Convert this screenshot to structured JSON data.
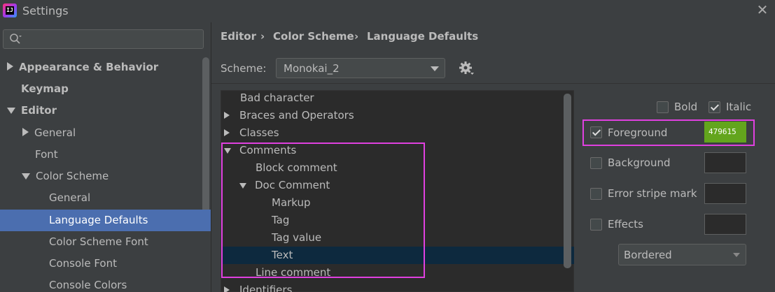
{
  "window": {
    "title": "Settings",
    "app_icon": "intellij-idea-icon",
    "close_icon": "close-icon"
  },
  "search": {
    "placeholder": "",
    "icon": "search-icon"
  },
  "sidebar": {
    "items": [
      {
        "label": "Appearance & Behavior",
        "expanded": false,
        "selected": false
      },
      {
        "label": "Keymap",
        "selected": false
      },
      {
        "label": "Editor",
        "expanded": true,
        "selected": false
      },
      {
        "label": "General",
        "expanded": false,
        "selected": false
      },
      {
        "label": "Font",
        "selected": false
      },
      {
        "label": "Color Scheme",
        "expanded": true,
        "selected": false
      },
      {
        "label": "General",
        "selected": false
      },
      {
        "label": "Language Defaults",
        "selected": true
      },
      {
        "label": "Color Scheme Font",
        "selected": false
      },
      {
        "label": "Console Font",
        "selected": false
      },
      {
        "label": "Console Colors",
        "selected": false
      }
    ]
  },
  "breadcrumb": {
    "items": [
      "Editor",
      "Color Scheme",
      "Language Defaults"
    ],
    "separator": "›"
  },
  "scheme": {
    "label": "Scheme:",
    "value": "Monokai_2",
    "gear_icon": "gear-icon"
  },
  "tree": {
    "items": [
      {
        "label": "Bad character",
        "selected": false
      },
      {
        "label": "Braces and Operators",
        "expanded": false,
        "selected": false
      },
      {
        "label": "Classes",
        "expanded": false,
        "selected": false
      },
      {
        "label": "Comments",
        "expanded": true,
        "selected": false
      },
      {
        "label": "Block comment",
        "selected": false
      },
      {
        "label": "Doc Comment",
        "expanded": true,
        "selected": false
      },
      {
        "label": "Markup",
        "selected": false
      },
      {
        "label": "Tag",
        "selected": false
      },
      {
        "label": "Tag value",
        "selected": false
      },
      {
        "label": "Text",
        "selected": true
      },
      {
        "label": "Line comment",
        "selected": false
      },
      {
        "label": "Identifiers",
        "expanded": false,
        "selected": false
      }
    ]
  },
  "attributes": {
    "bold": {
      "label": "Bold",
      "checked": false
    },
    "italic": {
      "label": "Italic",
      "checked": true
    },
    "foreground": {
      "label": "Foreground",
      "checked": true,
      "color_text": "479615",
      "color": "#63a51d"
    },
    "background": {
      "label": "Background",
      "checked": false
    },
    "error_stripe": {
      "label": "Error stripe mark",
      "checked": false
    },
    "effects": {
      "label": "Effects",
      "checked": false
    },
    "effects_type": "Bordered"
  },
  "colors": {
    "background": "#3c3f41",
    "selection": "#4b6eaf",
    "tree_selection": "#0d293e",
    "highlight": "#e040e0",
    "foreground_swatch": "#63a51d"
  }
}
